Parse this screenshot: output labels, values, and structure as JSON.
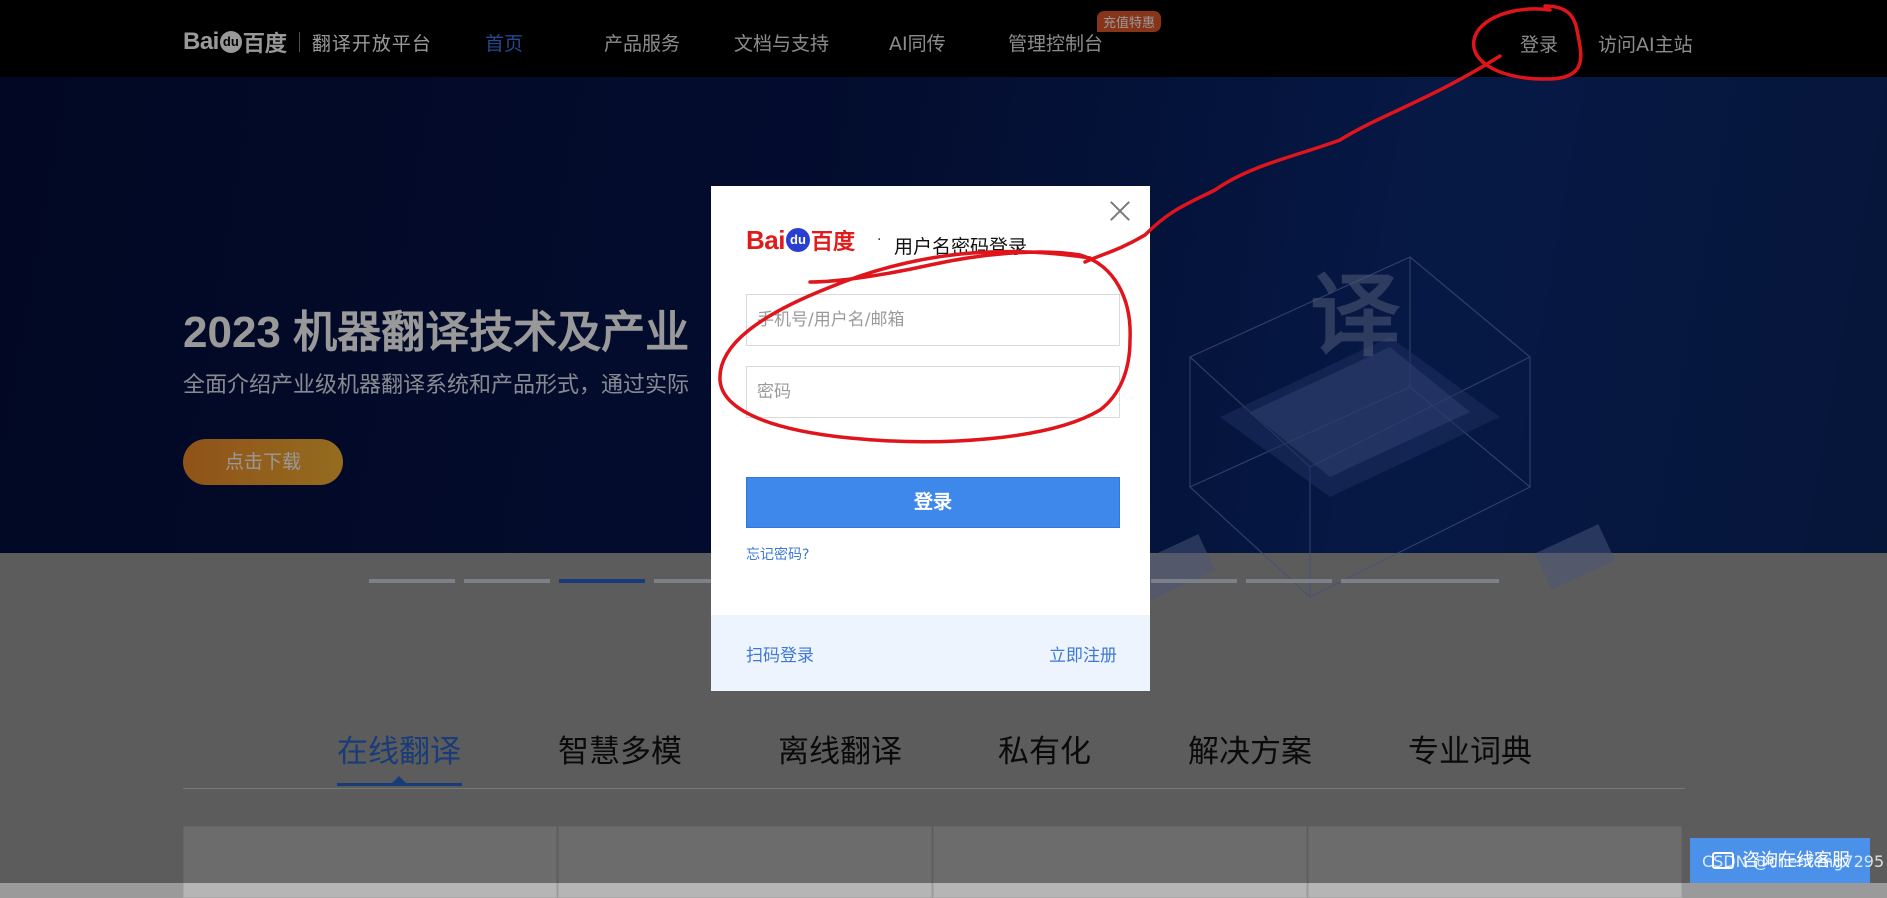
{
  "header": {
    "logo_bai": "Bai",
    "logo_du": "du",
    "logo_cn": "百度",
    "platform": "翻译开放平台",
    "nav": [
      "首页",
      "产品服务",
      "文档与支持",
      "AI同传",
      "管理控制台"
    ],
    "badge": "充值特惠",
    "login": "登录",
    "visit_ai": "访问AI主站"
  },
  "banner": {
    "title": "2023 机器翻译技术及产业",
    "subtitle": "全面介绍产业级机器翻译系统和产品形式，通过实际",
    "download": "点击下载"
  },
  "tabs": [
    "在线翻译",
    "智慧多模",
    "离线翻译",
    "私有化",
    "解决方案",
    "专业词典"
  ],
  "chat": {
    "label": "咨询在线客服"
  },
  "watermark": "CSDN @chenfeng7295",
  "modal": {
    "logo_bai": "Bai",
    "logo_du": "du",
    "logo_cn": "百度",
    "dot": "·",
    "title": "用户名密码登录",
    "username_placeholder": "手机号/用户名/邮箱",
    "password_placeholder": "密码",
    "login_button": "登录",
    "forgot": "忘记密码?",
    "qr_login": "扫码登录",
    "register": "立即注册"
  },
  "colors": {
    "accent": "#3e88eb",
    "link": "#3d78d8",
    "annotation": "#e0141b",
    "badge": "#e2572b",
    "brand_red": "#e01b1b"
  }
}
